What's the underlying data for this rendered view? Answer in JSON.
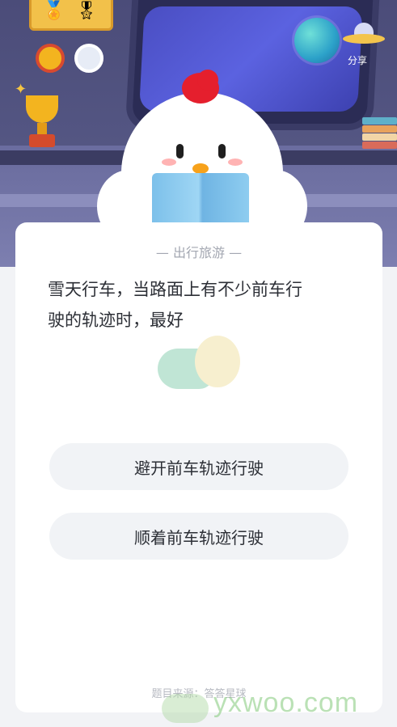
{
  "header": {
    "share_label": "分享"
  },
  "question": {
    "category": "— 出行旅游 —",
    "text_line1": "雪天行车，当路面上有不少前车行",
    "text_line2": "驶的轨迹时，最好"
  },
  "options": [
    {
      "label": "避开前车轨迹行驶"
    },
    {
      "label": "顺着前车轨迹行驶"
    }
  ],
  "footer": {
    "source": "题目来源：答答星球"
  },
  "watermark": {
    "text": "yxwoo.com"
  },
  "colors": {
    "background": "#f2f3f6",
    "card": "#ffffff",
    "option_bg": "#f1f3f6",
    "scene_purple": "#4b4c79",
    "comb_red": "#e51f2d"
  }
}
